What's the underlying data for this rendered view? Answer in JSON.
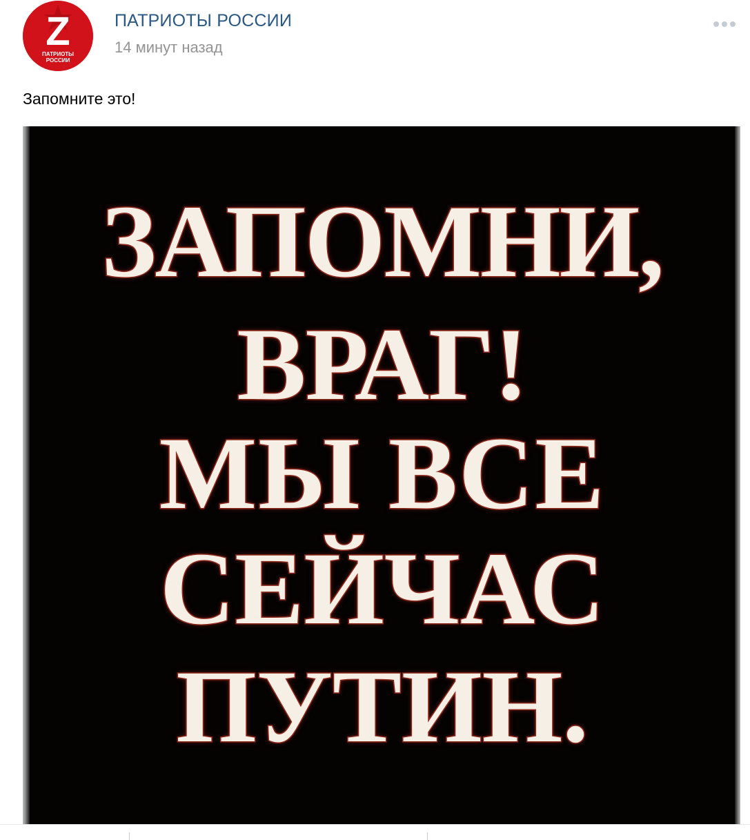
{
  "post": {
    "author": {
      "name": "ПАТРИОТЫ РОССИИ",
      "avatar_letter": "Z",
      "avatar_caption_line1": "ПАТРИОТЫ",
      "avatar_caption_line2": "РОССИИ",
      "avatar_color": "#d1121a"
    },
    "timestamp": "14 минут назад",
    "more_icon": "more-horizontal-icon",
    "text": "Запомните это!",
    "image": {
      "background_color": "#050202",
      "lines": [
        "ЗАПОМНИ,",
        "ВРАГ!",
        "МЫ ВСЕ",
        "СЕЙЧАС",
        "ПУТИН."
      ]
    }
  },
  "colors": {
    "link": "#2a5885",
    "muted": "#939393",
    "poster_text": "#f6efe6",
    "poster_outline": "#9c2a1c"
  }
}
